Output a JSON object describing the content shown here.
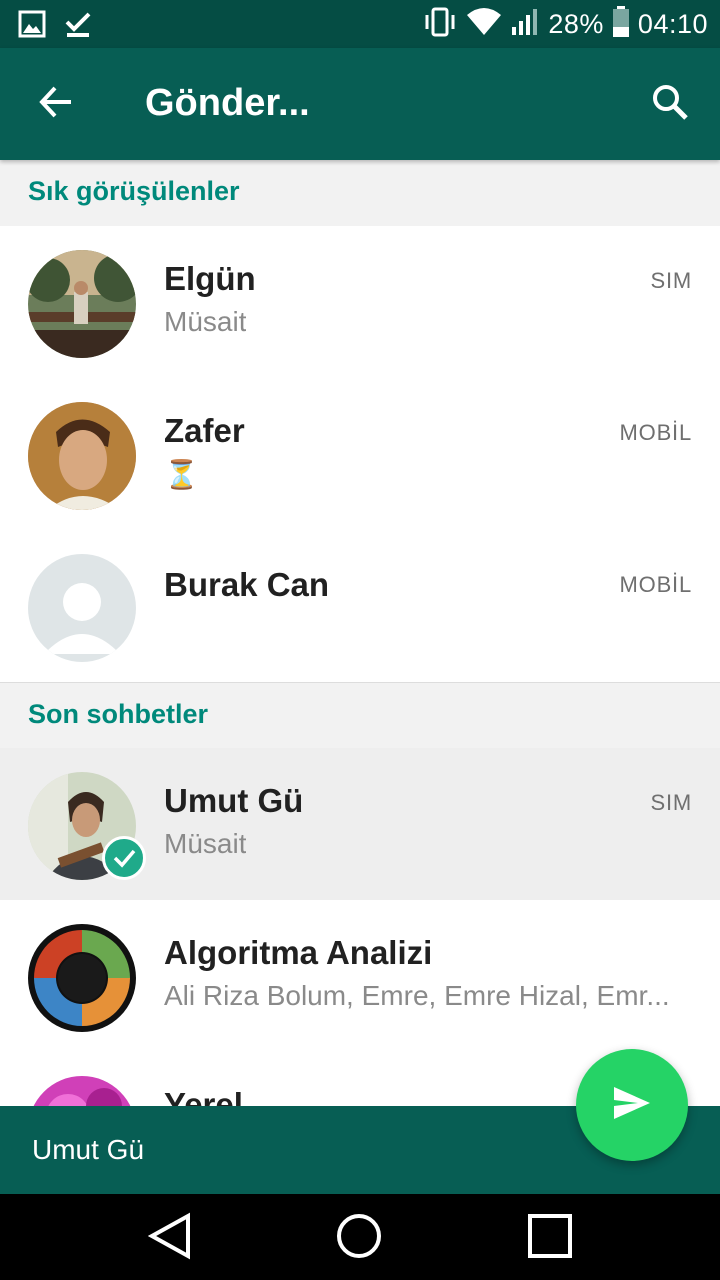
{
  "status_bar": {
    "battery_percent": "28%",
    "time": "04:10",
    "left_icons": [
      "gallery-notification-icon",
      "download-done-icon"
    ],
    "right_icons": [
      "vibrate-icon",
      "wifi-icon",
      "signal-icon",
      "battery-icon"
    ]
  },
  "app_bar": {
    "title": "Gönder...",
    "back_icon": "arrow-back-icon",
    "search_icon": "search-icon"
  },
  "sections": {
    "frequent": "Sık görüşülenler",
    "recent": "Son sohbetler"
  },
  "frequent_contacts": [
    {
      "name": "Elgün",
      "status": "Müsait",
      "phone_type": "SIM"
    },
    {
      "name": "Zafer",
      "status": "⏳",
      "phone_type": "MOBİL"
    },
    {
      "name": "Burak Can",
      "status": "",
      "phone_type": "MOBİL"
    }
  ],
  "recent_chats": [
    {
      "name": "Umut Gü",
      "status": "Müsait",
      "phone_type": "SIM",
      "selected": true
    },
    {
      "name": "Algoritma Analizi",
      "status": "Ali Riza Bolum, Emre, Emre Hizal, Emr...",
      "phone_type": ""
    },
    {
      "name": "Yerel",
      "status": "",
      "phone_type": ""
    }
  ],
  "selection_bar": {
    "text": "Umut Gü"
  },
  "fab": {
    "icon": "send-icon"
  },
  "colors": {
    "primary": "#075e54",
    "primary_dark": "#054d44",
    "accent": "#25d366",
    "section_text": "#00897b"
  }
}
